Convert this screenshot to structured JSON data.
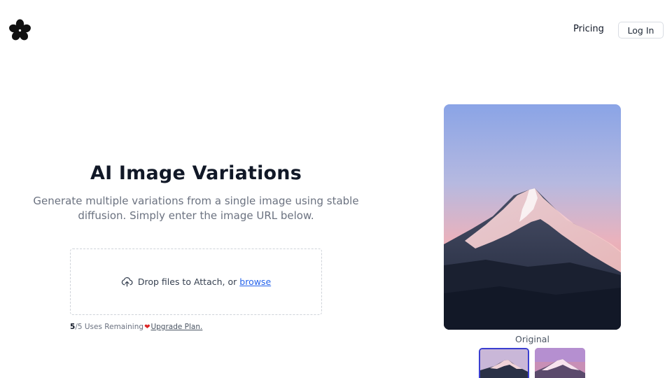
{
  "header": {
    "logo_icon": "flower-logo-icon",
    "nav": {
      "pricing_label": "Pricing",
      "login_label": "Log In"
    }
  },
  "hero": {
    "title": "AI Image Variations",
    "subtitle": "Generate multiple variations from a single image using stable diffusion. Simply enter the image URL below."
  },
  "upload": {
    "icon": "cloud-upload-icon",
    "prompt": "Drop files to Attach, or",
    "browse_label": "browse"
  },
  "usage": {
    "remaining": "5",
    "total_text": "/5 Uses Remaining",
    "heart_icon": "heart-icon",
    "upgrade_label": "Upgrade Plan."
  },
  "preview": {
    "caption": "Original",
    "thumbnails": [
      {
        "name": "original",
        "selected": true
      },
      {
        "name": "variation-1",
        "selected": false
      }
    ]
  },
  "colors": {
    "text": "#111827",
    "muted": "#6b7280",
    "link": "#2563eb",
    "selected_border": "#3b3fd0",
    "heart": "#dc2626"
  }
}
